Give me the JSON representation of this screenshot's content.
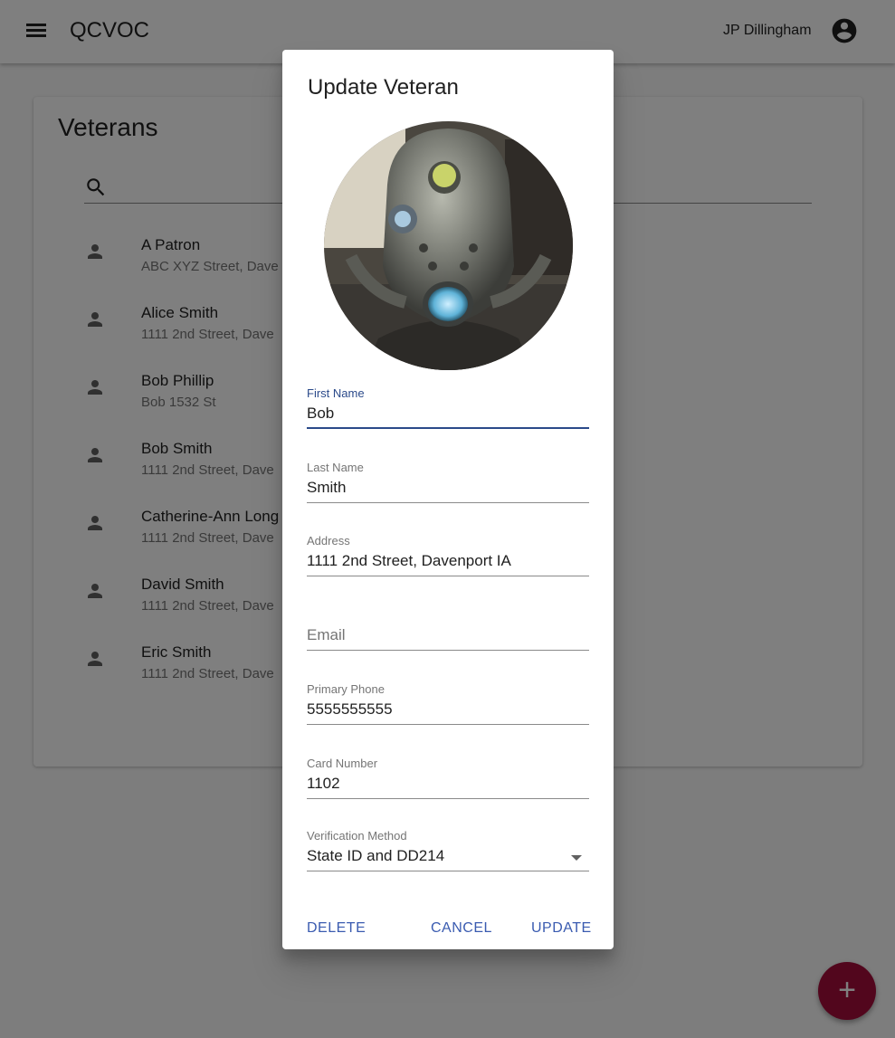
{
  "appbar": {
    "title": "QCVOC",
    "user_name": "JP Dillingham",
    "menu_icon": "menu-icon",
    "account_icon": "account-circle-icon"
  },
  "card": {
    "title": "Veterans",
    "search_icon": "search-icon",
    "veterans": [
      {
        "name": "A Patron",
        "address": "ABC XYZ Street, Dave"
      },
      {
        "name": "Alice Smith",
        "address": "1111 2nd Street, Dave"
      },
      {
        "name": "Bob Phillip",
        "address": "Bob 1532 St"
      },
      {
        "name": "Bob Smith",
        "address": "1111 2nd Street, Dave"
      },
      {
        "name": "Catherine-Ann Long",
        "address": "1111 2nd Street, Dave"
      },
      {
        "name": "David Smith",
        "address": "1111 2nd Street, Dave"
      },
      {
        "name": "Eric Smith",
        "address": "1111 2nd Street, Dave"
      }
    ]
  },
  "dialog": {
    "title": "Update Veteran",
    "fields": {
      "first_name": {
        "label": "First Name",
        "value": "Bob"
      },
      "last_name": {
        "label": "Last Name",
        "value": "Smith"
      },
      "address": {
        "label": "Address",
        "value": "1111 2nd Street, Davenport IA"
      },
      "email": {
        "placeholder": "Email",
        "value": ""
      },
      "primary_phone": {
        "label": "Primary Phone",
        "value": "5555555555"
      },
      "card_number": {
        "label": "Card Number",
        "value": "1102"
      },
      "verification_method": {
        "label": "Verification Method",
        "value": "State ID and DD214"
      }
    },
    "buttons": {
      "delete": "DELETE",
      "cancel": "CANCEL",
      "update": "UPDATE"
    }
  },
  "fab": {
    "label": "+",
    "icon": "add-icon"
  },
  "colors": {
    "primary": "#2b4a8a",
    "button_text": "#3a5bb0",
    "fab": "#a50d3b",
    "overlay": "rgba(0,0,0,0.5)"
  }
}
